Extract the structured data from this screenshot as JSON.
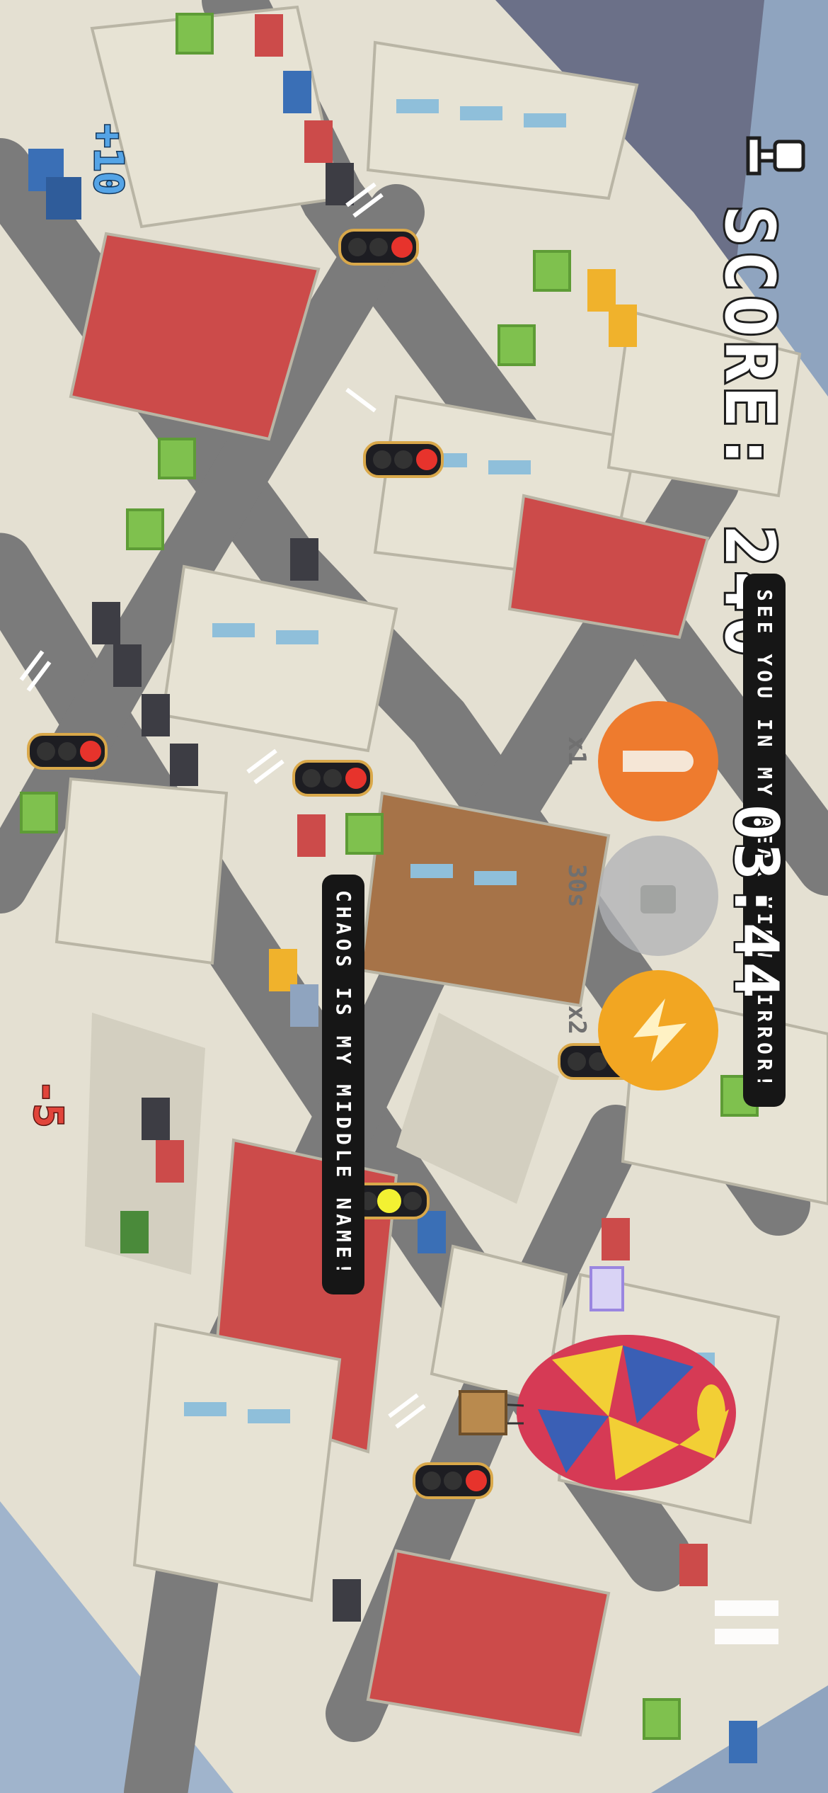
{
  "hud": {
    "score_label": "SCORE:",
    "score_value": "240",
    "timer": "03:44",
    "banner_top": "SEE YOU IN MY REAR VIEW MIRROR!",
    "banner_bottom": "CHAOS IS MY MIDDLE NAME!"
  },
  "powerups": [
    {
      "name": "rocket",
      "count": "x1",
      "color": "#ee7b2e",
      "icon": "rocket-icon"
    },
    {
      "name": "locked",
      "count": "30s",
      "color": "#b0b2b5",
      "icon": "lock-icon"
    },
    {
      "name": "lightning",
      "count": "x2",
      "color": "#f2a622",
      "icon": "lightning-icon"
    }
  ],
  "popups": {
    "plus": "+10",
    "minus": "-5"
  },
  "colors": {
    "ground": "#e4e0d2",
    "road": "#7b7b7b",
    "building_light": "#e7e3d4",
    "building_red": "#cc4b4a",
    "building_brown": "#a67348",
    "tree": "#7fc14e",
    "water": "#8fa4bf",
    "traffic_red": "#e7332c",
    "traffic_yellow": "#f3f132"
  }
}
